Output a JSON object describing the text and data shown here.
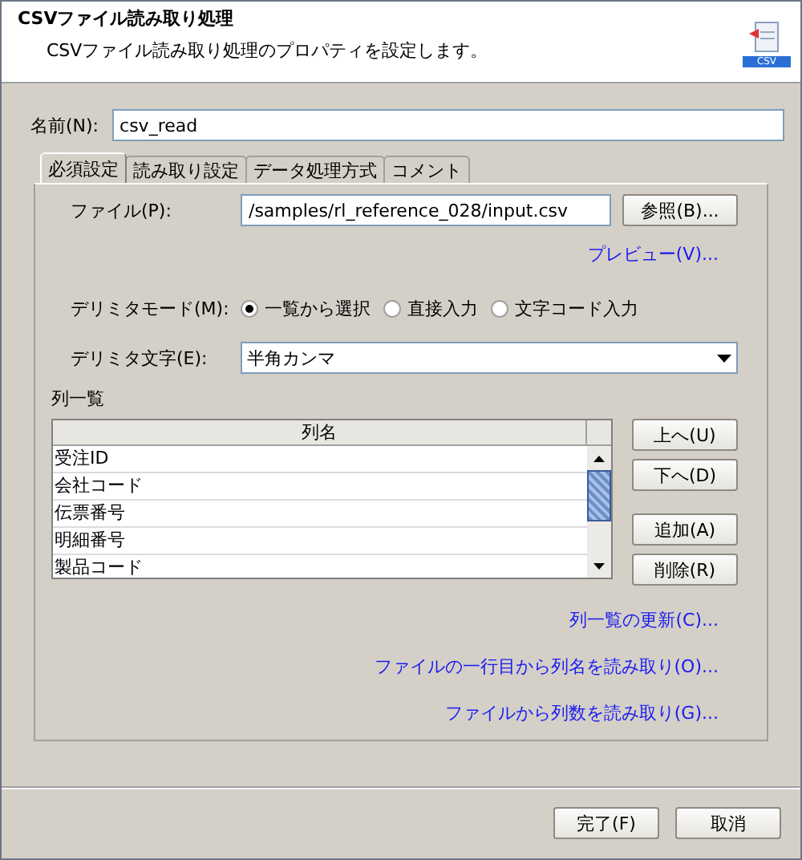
{
  "header": {
    "title": "CSVファイル読み取り処理",
    "subtitle": "CSVファイル読み取り処理のプロパティを設定します。",
    "icon_label": "CSV"
  },
  "name_field": {
    "label": "名前(N):",
    "value": "csv_read"
  },
  "tabs": [
    {
      "label": "必須設定",
      "selected": true
    },
    {
      "label": "読み取り設定",
      "selected": false
    },
    {
      "label": "データ処理方式",
      "selected": false
    },
    {
      "label": "コメント",
      "selected": false
    }
  ],
  "file_field": {
    "label": "ファイル(P):",
    "value": "/samples/rl_reference_028/input.csv",
    "button": "参照(B)..."
  },
  "preview_link": "プレビュー(V)...",
  "delimiter_mode": {
    "label": "デリミタモード(M):",
    "options": [
      {
        "label": "一覧から選択",
        "selected": true
      },
      {
        "label": "直接入力",
        "selected": false
      },
      {
        "label": "文字コード入力",
        "selected": false
      }
    ]
  },
  "delimiter_char": {
    "label": "デリミタ文字(E):",
    "value": "半角カンマ"
  },
  "column_list": {
    "label": "列一覧",
    "header": "列名",
    "rows": [
      "受注ID",
      "会社コード",
      "伝票番号",
      "明細番号",
      "製品コード"
    ],
    "buttons": [
      "上へ(U)",
      "下へ(D)",
      "追加(A)",
      "削除(R)"
    ]
  },
  "links": [
    "列一覧の更新(C)...",
    "ファイルの一行目から列名を読み取り(O)...",
    "ファイルから列数を読み取り(G)..."
  ],
  "footer_buttons": [
    "完了(F)",
    "取消"
  ]
}
